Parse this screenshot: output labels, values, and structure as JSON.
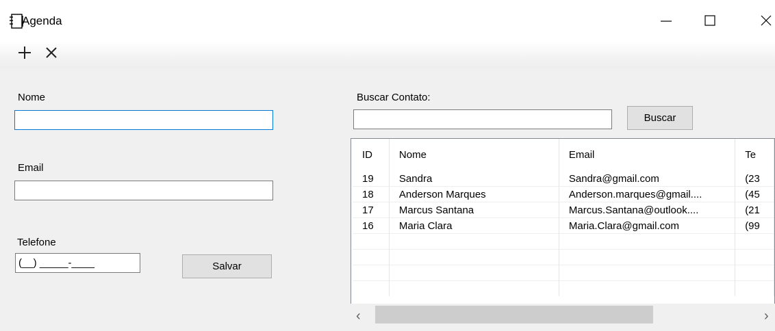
{
  "window": {
    "title": "Agenda",
    "app_icon": "notebook-icon"
  },
  "toolbar": {
    "add_icon": "plus-icon",
    "delete_icon": "close-icon"
  },
  "form": {
    "nome_label": "Nome",
    "nome_value": "",
    "email_label": "Email",
    "email_value": "",
    "telefone_label": "Telefone",
    "telefone_mask": "(__) _____-____",
    "save_label": "Salvar"
  },
  "search": {
    "label": "Buscar Contato:",
    "value": "",
    "button_label": "Buscar"
  },
  "grid": {
    "columns": [
      "ID",
      "Nome",
      "Email",
      "Te"
    ],
    "rows": [
      [
        "19",
        "Sandra",
        "Sandra@gmail.com",
        "(23"
      ],
      [
        "18",
        "Anderson Marques",
        "Anderson.marques@gmail....",
        "(45"
      ],
      [
        "17",
        "Marcus Santana",
        "Marcus.Santana@outlook....",
        "(21"
      ],
      [
        "16",
        "Maria Clara",
        "Maria.Clara@gmail.com",
        "(99"
      ]
    ]
  },
  "scrollbar": {
    "left_arrow": "‹",
    "right_arrow": "›"
  }
}
